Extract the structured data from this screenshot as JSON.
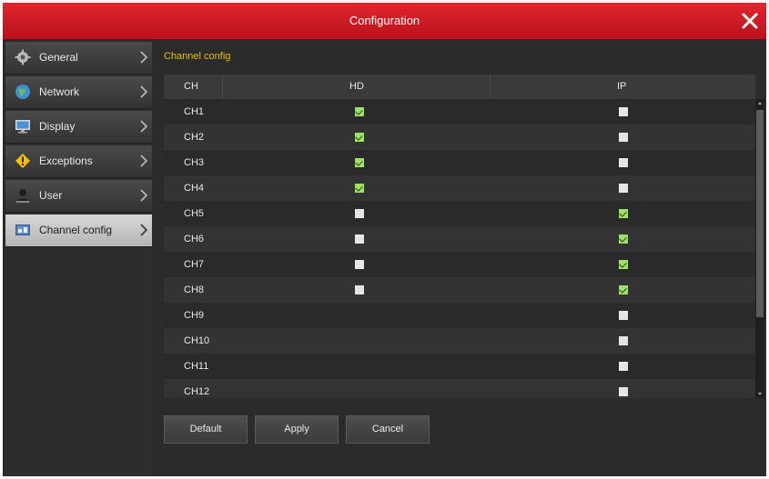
{
  "window": {
    "title": "Configuration",
    "close_icon": "close-icon"
  },
  "sidebar": {
    "items": [
      {
        "label": "General",
        "icon": "gear-icon",
        "active": false
      },
      {
        "label": "Network",
        "icon": "globe-icon",
        "active": false
      },
      {
        "label": "Display",
        "icon": "monitor-icon",
        "active": false
      },
      {
        "label": "Exceptions",
        "icon": "warning-icon",
        "active": false
      },
      {
        "label": "User",
        "icon": "user-icon",
        "active": false
      },
      {
        "label": "Channel config",
        "icon": "channel-icon",
        "active": true
      }
    ]
  },
  "main": {
    "section_title": "Channel config",
    "columns": [
      "CH",
      "HD",
      "IP"
    ],
    "rows": [
      {
        "ch": "CH1",
        "hd": true,
        "ip": false
      },
      {
        "ch": "CH2",
        "hd": true,
        "ip": false
      },
      {
        "ch": "CH3",
        "hd": true,
        "ip": false
      },
      {
        "ch": "CH4",
        "hd": true,
        "ip": false
      },
      {
        "ch": "CH5",
        "hd": false,
        "ip": true
      },
      {
        "ch": "CH6",
        "hd": false,
        "ip": true
      },
      {
        "ch": "CH7",
        "hd": false,
        "ip": true
      },
      {
        "ch": "CH8",
        "hd": false,
        "ip": true
      },
      {
        "ch": "CH9",
        "hd": null,
        "ip": false
      },
      {
        "ch": "CH10",
        "hd": null,
        "ip": false
      },
      {
        "ch": "CH11",
        "hd": null,
        "ip": false
      },
      {
        "ch": "CH12",
        "hd": null,
        "ip": false
      }
    ]
  },
  "buttons": {
    "default_label": "Default",
    "apply_label": "Apply",
    "cancel_label": "Cancel"
  },
  "colors": {
    "title_red": "#d11b23",
    "section_title": "#e4c200",
    "checked_green": "#9ee068"
  }
}
